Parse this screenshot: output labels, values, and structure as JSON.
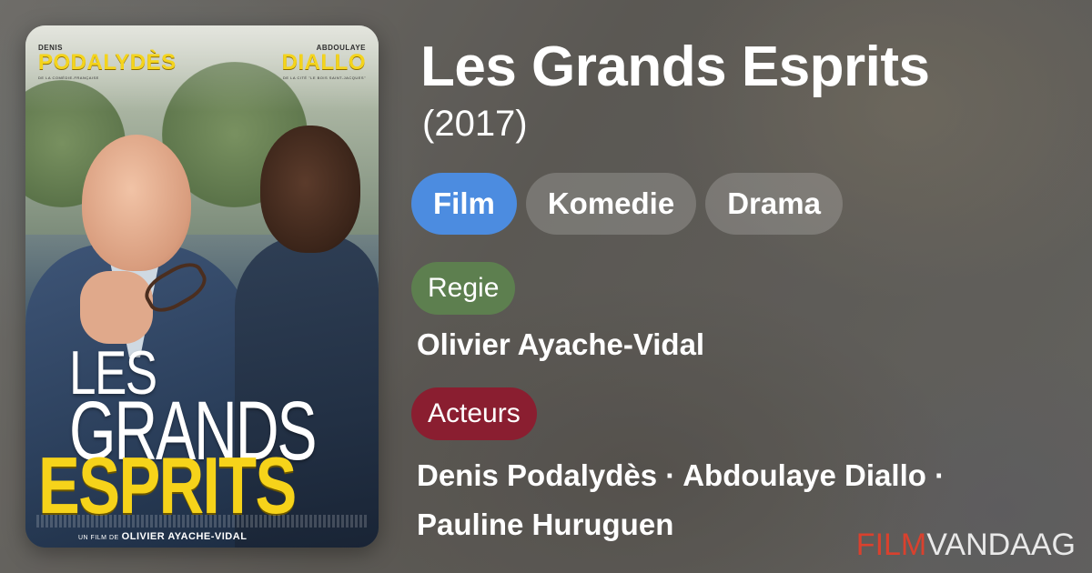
{
  "movie": {
    "title": "Les Grands Esprits",
    "year": "(2017)"
  },
  "genres": [
    "Film",
    "Komedie",
    "Drama"
  ],
  "direction": {
    "label": "Regie",
    "value": "Olivier Ayache-Vidal"
  },
  "cast": {
    "label": "Acteurs",
    "value": "Denis Podalydès · Abdoulaye Diallo · Pauline Huruguen"
  },
  "poster": {
    "actor_left_first": "DENIS",
    "actor_left_last": "PODALYDÈS",
    "actor_left_sub": "DE LA COMÉDIE-FRANÇAISE",
    "actor_right_first": "ABDOULAYE",
    "actor_right_last": "DIALLO",
    "actor_right_sub": "DE LA CITÉ \"LE BOIS SAINT-JACQUES\"",
    "title_line1": "LES",
    "title_line2": "GRANDS",
    "title_line3": "ESPRITS",
    "director_prefix": "UN FILM DE",
    "director_name": "OLIVIER AYACHE-VIDAL"
  },
  "brand": {
    "part1": "FILM",
    "part2": "VANDAAG"
  },
  "colors": {
    "chip_active": "#4c8ce0",
    "regie_pill": "#5d7f4f",
    "acteurs_pill": "#8a1e30",
    "brand_red": "#d9412e",
    "poster_yellow": "#f6d31a"
  }
}
